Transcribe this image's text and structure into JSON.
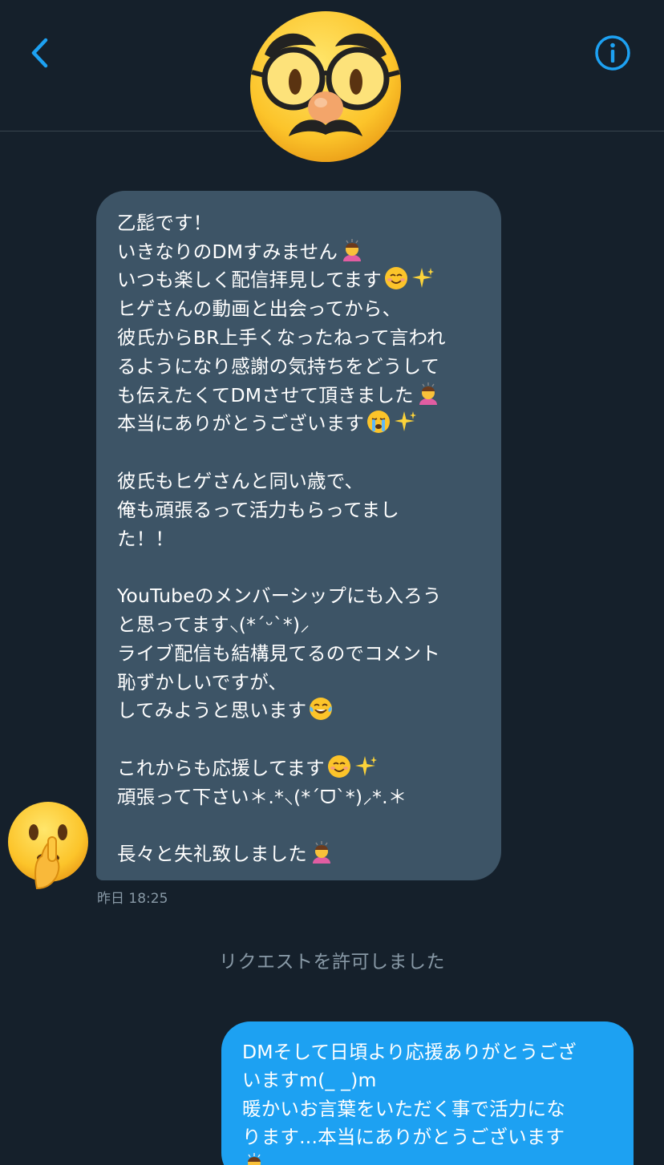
{
  "header": {
    "back_icon": "chevron-left-icon",
    "info_icon": "info-circle-icon",
    "avatar_icon": "disguised-face-emoji",
    "accent": "#1da1f2"
  },
  "messages": {
    "received": {
      "avatar_icon": "shushing-face-emoji",
      "bubble_color": "#3d5466",
      "lines": [
        "乙髭です！",
        "いきなりのDMすみません",
        "いつも楽しく配信拝見してます",
        "ヒゲさんの動画と出会ってから、",
        "彼氏からBR上手くなったねって言われ",
        "るようになり感謝の気持ちをどうして",
        "も伝えたくてDMさせて頂きました",
        "本当にありがとうございます",
        "",
        "彼氏もヒゲさんと同い歳で、",
        "俺も頑張るって活力もらってまし",
        "た！！",
        "",
        "YouTubeのメンバーシップにも入ろう",
        "と思ってます⸜(*ˊᵕˋ*)⸝",
        "ライブ配信も結構見てるのでコメント",
        "恥ずかしいですが、",
        "してみようと思います",
        "",
        "これからも応援してます",
        "頑張って下さい＊.*⸜(*ˊᗜˋ*)⸝*.＊",
        "",
        "長々と失礼致しました"
      ],
      "timestamp": "昨日 18:25"
    },
    "system_notice": "リクエストを許可しました",
    "sent": {
      "bubble_color": "#1da1f2",
      "lines": [
        "DMそして日頃より応援ありがとうござ",
        "いますm(_ _)m",
        "暖かいお言葉をいただく事で活力にな",
        "ります...本当にありがとうございます"
      ]
    }
  }
}
